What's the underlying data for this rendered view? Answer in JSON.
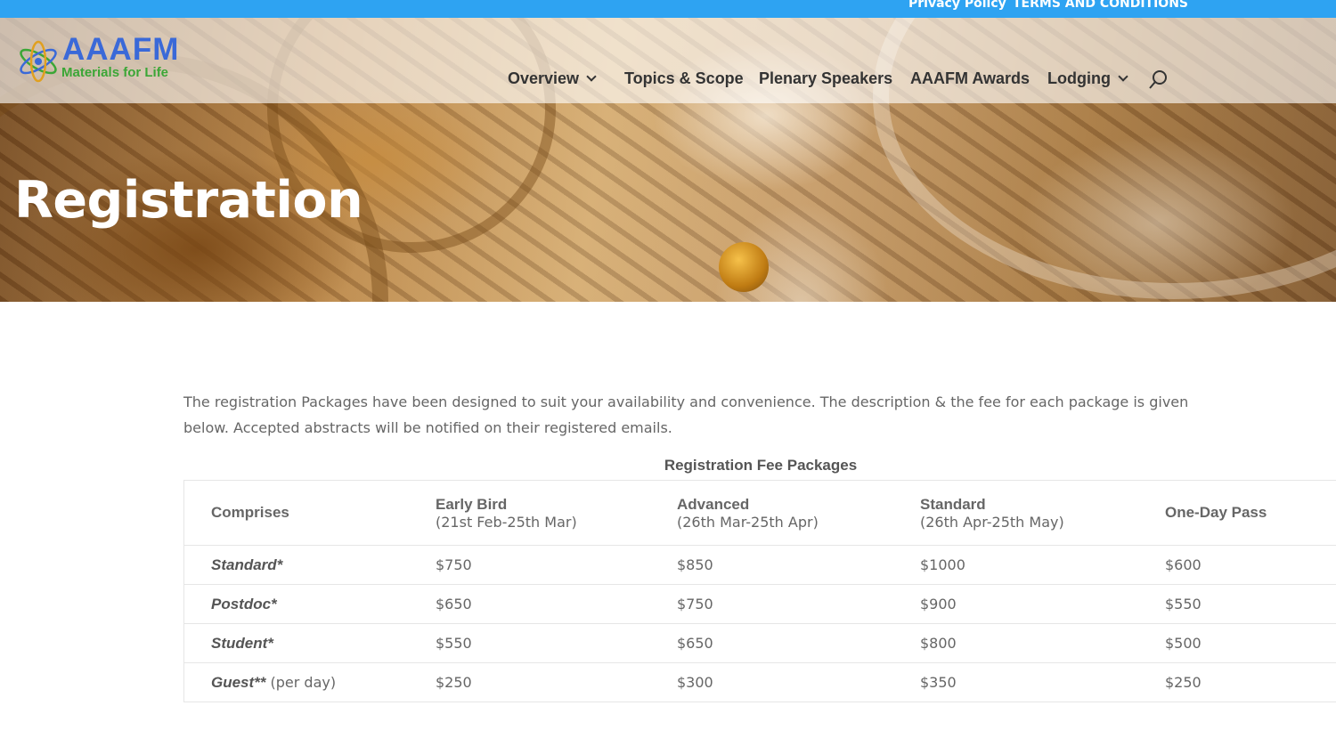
{
  "topbar": {
    "privacy_link": "Privacy Policy",
    "terms_link": "TERMS AND CONDITIONS"
  },
  "logo": {
    "brand": "AAAFM",
    "tagline": "Materials for Life"
  },
  "nav": {
    "overview": "Overview",
    "topics": "Topics & Scope",
    "speakers": "Plenary Speakers",
    "awards": "AAAFM Awards",
    "lodging": "Lodging"
  },
  "hero": {
    "title": "Registration"
  },
  "intro": "The registration Packages have been designed to suit your availability and convenience. The description & the fee for each package is given below. Accepted abstracts will be notified on their registered emails.",
  "table": {
    "caption": "Registration Fee Packages",
    "columns": [
      {
        "label": "Comprises",
        "sub": ""
      },
      {
        "label": "Early Bird",
        "sub": "(21st Feb-25th Mar)"
      },
      {
        "label": "Advanced",
        "sub": "(26th Mar-25th Apr)"
      },
      {
        "label": "Standard",
        "sub": "(26th Apr-25th May)"
      },
      {
        "label": "One-Day Pass",
        "sub": ""
      }
    ],
    "rows": [
      {
        "label": "Standard*",
        "note": "",
        "values": [
          "$750",
          "$850",
          "$1000",
          "$600"
        ]
      },
      {
        "label": "Postdoc*",
        "note": "",
        "values": [
          "$650",
          "$750",
          "$900",
          "$550"
        ]
      },
      {
        "label": "Student*",
        "note": "",
        "values": [
          "$550",
          "$650",
          "$800",
          "$500"
        ]
      },
      {
        "label": "Guest**",
        "note": " (per day)",
        "values": [
          "$250",
          "$300",
          "$350",
          "$250"
        ]
      }
    ]
  },
  "colors": {
    "topbar": "#2ea3f2",
    "brand_blue": "#3a69d8",
    "brand_green": "#3ba636"
  }
}
